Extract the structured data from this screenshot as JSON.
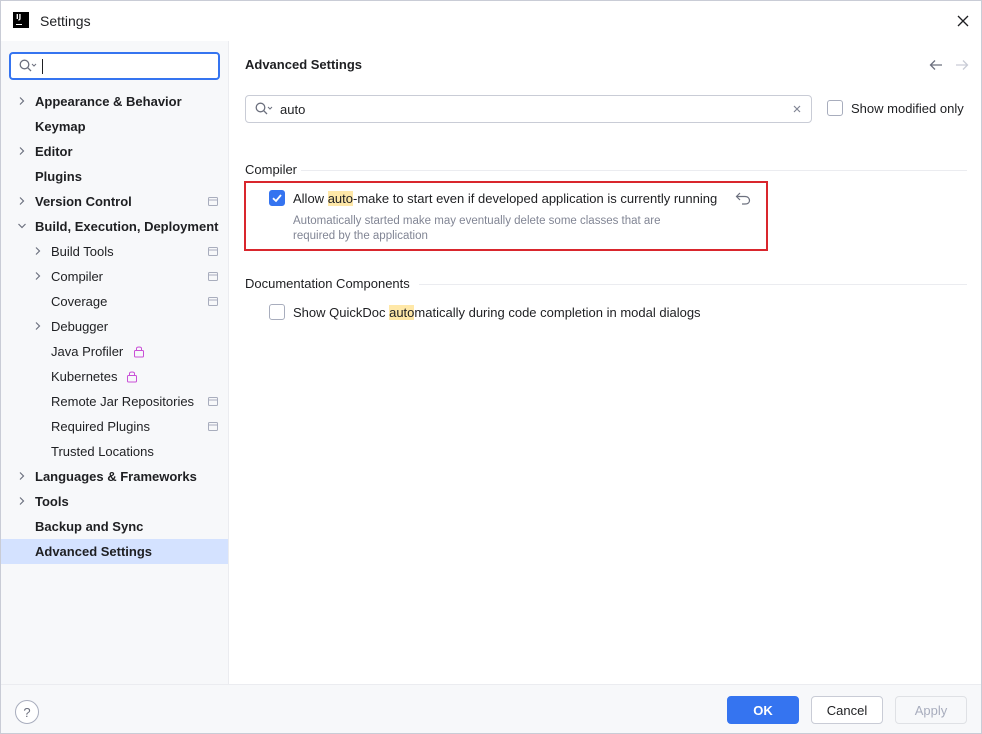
{
  "window": {
    "title": "Settings"
  },
  "sidebar": {
    "search": {
      "value": ""
    },
    "items": [
      {
        "label": "Appearance & Behavior",
        "level": 0,
        "expandable": true,
        "expanded": false
      },
      {
        "label": "Keymap",
        "level": 0,
        "expandable": false
      },
      {
        "label": "Editor",
        "level": 0,
        "expandable": true,
        "expanded": false
      },
      {
        "label": "Plugins",
        "level": 0,
        "expandable": false
      },
      {
        "label": "Version Control",
        "level": 0,
        "expandable": true,
        "expanded": false,
        "project_icon": true
      },
      {
        "label": "Build, Execution, Deployment",
        "level": 0,
        "expandable": true,
        "expanded": true
      },
      {
        "label": "Build Tools",
        "level": 1,
        "expandable": true,
        "project_icon": true
      },
      {
        "label": "Compiler",
        "level": 1,
        "expandable": true,
        "project_icon": true
      },
      {
        "label": "Coverage",
        "level": 1,
        "expandable": false,
        "project_icon": true
      },
      {
        "label": "Debugger",
        "level": 1,
        "expandable": true
      },
      {
        "label": "Java Profiler",
        "level": 1,
        "expandable": false,
        "lock_icon": true
      },
      {
        "label": "Kubernetes",
        "level": 1,
        "expandable": false,
        "lock_icon": true
      },
      {
        "label": "Remote Jar Repositories",
        "level": 1,
        "expandable": false,
        "project_icon": true
      },
      {
        "label": "Required Plugins",
        "level": 1,
        "expandable": false,
        "project_icon": true
      },
      {
        "label": "Trusted Locations",
        "level": 1,
        "expandable": false
      },
      {
        "label": "Languages & Frameworks",
        "level": 0,
        "expandable": true,
        "expanded": false
      },
      {
        "label": "Tools",
        "level": 0,
        "expandable": true,
        "expanded": false
      },
      {
        "label": "Backup and Sync",
        "level": 0,
        "expandable": false
      },
      {
        "label": "Advanced Settings",
        "level": 0,
        "expandable": false,
        "selected": true
      }
    ]
  },
  "main": {
    "title": "Advanced Settings",
    "filter": {
      "value": "auto"
    },
    "show_modified_only": {
      "label": "Show modified only",
      "checked": false
    },
    "sections": [
      {
        "header": "Compiler",
        "options": [
          {
            "pre": "Allow ",
            "match": "auto",
            "post": "-make to start even if developed application is currently running",
            "checked": true,
            "description_line1": "Automatically started make may eventually delete some classes that are",
            "description_line2": "required by the application"
          }
        ]
      },
      {
        "header": "Documentation Components",
        "options": [
          {
            "pre": "Show QuickDoc ",
            "match": "auto",
            "post": "matically during code completion in modal dialogs",
            "checked": false
          }
        ]
      }
    ]
  },
  "footer": {
    "help_label": "?",
    "ok_label": "OK",
    "cancel_label": "Cancel",
    "apply_label": "Apply"
  },
  "colors": {
    "accent": "#3574f0",
    "selection": "#d4e2ff",
    "search_highlight": "#ffe8a8",
    "annotation_box": "#d9262d",
    "lock_icon": "#c94fd6"
  }
}
